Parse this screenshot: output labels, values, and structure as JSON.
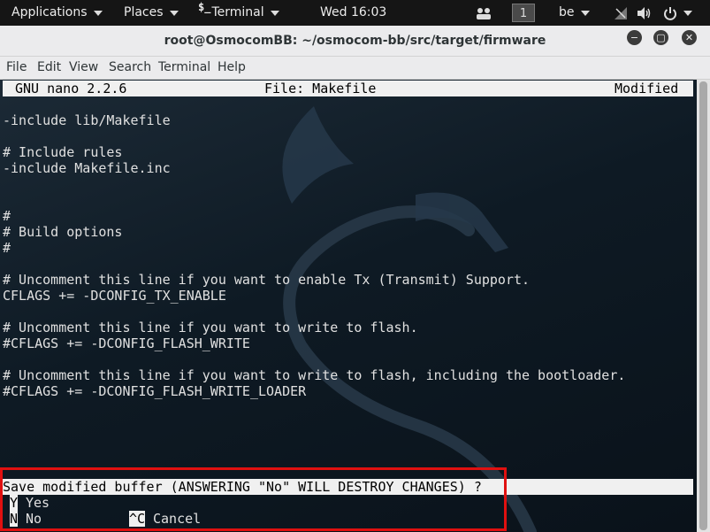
{
  "topbar": {
    "applications": "Applications",
    "places": "Places",
    "terminal_glyph": "$_",
    "terminal": "Terminal",
    "clock": "Wed 16:03",
    "workspace": "1",
    "keyboard": "be"
  },
  "window": {
    "title": "root@OsmocomBB: ~/osmocom-bb/src/target/firmware",
    "minimize": "−",
    "maximize": "▢",
    "close": "✕"
  },
  "menu": [
    "File",
    "Edit",
    "View",
    "Search",
    "Terminal",
    "Help"
  ],
  "nano": {
    "app": "GNU nano 2.2.6",
    "file": "File: Makefile",
    "status": "Modified"
  },
  "lines": [
    "-include lib/Makefile",
    "# Include rules",
    "-include Makefile.inc",
    "#",
    "# Build options",
    "#",
    "# Uncomment this line if you want to enable Tx (Transmit) Support.",
    "CFLAGS += -DCONFIG_TX_ENABLE",
    "# Uncomment this line if you want to write to flash.",
    "#CFLAGS += -DCONFIG_FLASH_WRITE",
    "# Uncomment this line if you want to write to flash, including the bootloader.",
    "#CFLAGS += -DCONFIG_FLASH_WRITE_LOADER"
  ],
  "prompt": {
    "question": "Save modified buffer (ANSWERING \"No\" WILL DESTROY CHANGES) ?",
    "yes_key": "Y",
    "yes_label": "Yes",
    "no_key": "N",
    "no_label": "No",
    "cancel_key": "^C",
    "cancel_label": "Cancel"
  },
  "colors": {
    "highlight_box": "#e01010",
    "terminal_bg": "#0e1a24"
  }
}
